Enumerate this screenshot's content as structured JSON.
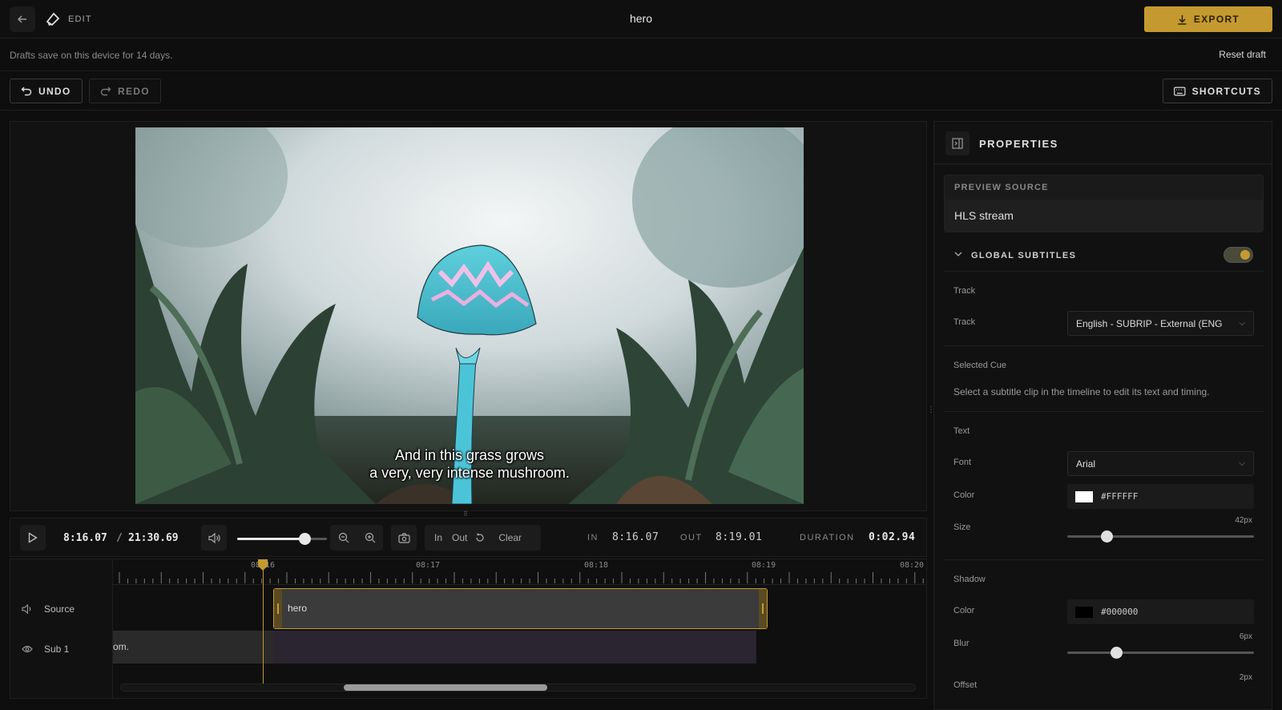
{
  "header": {
    "edit_label": "EDIT",
    "title": "hero",
    "export_label": "EXPORT"
  },
  "info": {
    "drafts_text": "Drafts save on this device for 14 days.",
    "reset_label": "Reset draft"
  },
  "toolbar": {
    "undo_label": "UNDO",
    "redo_label": "REDO",
    "shortcuts_label": "SHORTCUTS"
  },
  "preview": {
    "subtitle_line1": "And in this grass grows",
    "subtitle_line2": "a very, very intense mushroom."
  },
  "controls": {
    "current_time": "8:16.07",
    "separator": "/",
    "total_time": "21:30.69",
    "volume": 0.75,
    "in_label": "In",
    "out_label": "Out",
    "clear_label": "Clear",
    "in_tc_label": "IN",
    "in_tc_value": "8:16.07",
    "out_tc_label": "OUT",
    "out_tc_value": "8:19.01",
    "duration_label": "DURATION",
    "duration_value": "0:02.94"
  },
  "timeline": {
    "ticks": [
      "08:16",
      "08:17",
      "08:18",
      "08:19",
      "08:20"
    ],
    "tracks": [
      {
        "label": "Source",
        "icon": "speaker-icon"
      },
      {
        "label": "Sub 1",
        "icon": "eye-icon"
      }
    ],
    "source_clip_label": "hero",
    "sub_clip_text": "om."
  },
  "properties": {
    "title": "PROPERTIES",
    "preview_source_label": "PREVIEW SOURCE",
    "preview_source_value": "HLS stream",
    "global_subtitles_label": "GLOBAL SUBTITLES",
    "global_subtitles_enabled": true,
    "track_section": "Track",
    "track_label": "Track",
    "track_value": "English - SUBRIP - External (ENG",
    "selected_cue_label": "Selected Cue",
    "selected_cue_hint": "Select a subtitle clip in the timeline to edit its text and timing.",
    "text_section": "Text",
    "font_label": "Font",
    "font_value": "Arial",
    "color_label": "Color",
    "color_value": "#FFFFFF",
    "size_label": "Size",
    "size_value": "42px",
    "size_level": 0.21,
    "shadow_section": "Shadow",
    "shadow_color_label": "Color",
    "shadow_color_value": "#000000",
    "blur_label": "Blur",
    "blur_value": "6px",
    "blur_level": 0.26,
    "offset_label": "Offset",
    "offset_value": "2px"
  },
  "colors": {
    "accent": "#c49a30",
    "background": "#0e0e0e"
  }
}
